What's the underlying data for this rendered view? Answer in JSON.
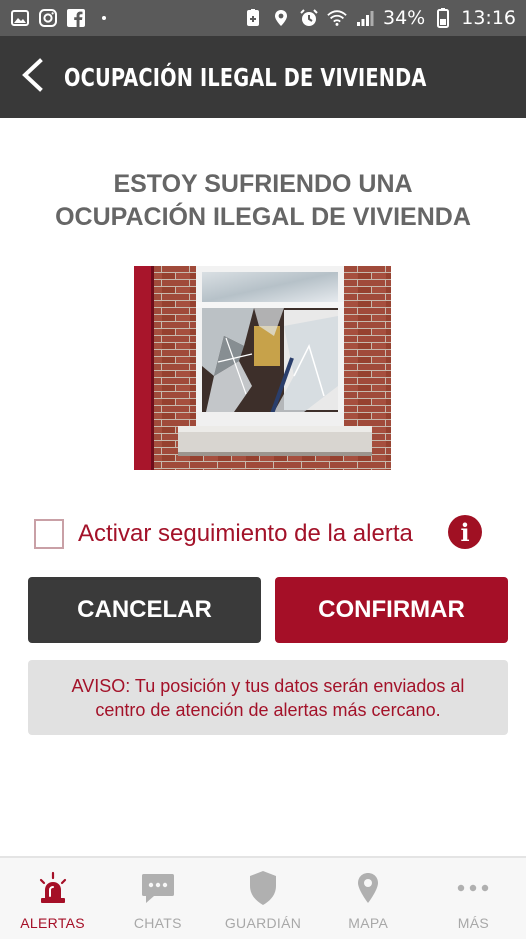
{
  "statusbar": {
    "left_icons": [
      "image-icon",
      "instagram-icon",
      "facebook-icon",
      "dot-icon"
    ],
    "right_icons": [
      "cast-icon",
      "location-icon",
      "alarm-icon",
      "wifi-icon",
      "signal-icon"
    ],
    "battery": "34%",
    "time": "13:16"
  },
  "appbar": {
    "back_icon": "chevron-left-icon",
    "title": "OCUPACIÓN ILEGAL DE VIVIENDA"
  },
  "main": {
    "heading_line1": "ESTOY SUFRIENDO UNA",
    "heading_line2": "OCUPACIÓN ILEGAL DE VIVIENDA",
    "image_description": "broken-window-photo",
    "tracking_label": "Activar seguimiento de la alerta",
    "tracking_checked": false,
    "info_icon": "i",
    "cancel_label": "CANCELAR",
    "confirm_label": "CONFIRMAR",
    "notice_line1": "AVISO: Tu posición y tus datos serán enviados al",
    "notice_line2": "centro de atención de alertas más cercano."
  },
  "colors": {
    "accent": "#a50f27",
    "appbar": "#393939",
    "statusbar": "#5a5a5a",
    "cancel": "#3a3a3a",
    "notice_bg": "#e1e1e1"
  },
  "bottom_nav": {
    "items": [
      {
        "label": "ALERTAS",
        "icon": "siren-icon",
        "active": true
      },
      {
        "label": "CHATS",
        "icon": "chat-icon",
        "active": false
      },
      {
        "label": "GUARDIÁN",
        "icon": "shield-icon",
        "active": false
      },
      {
        "label": "MAPA",
        "icon": "map-pin-icon",
        "active": false
      },
      {
        "label": "MÁS",
        "icon": "more-icon",
        "active": false
      }
    ]
  }
}
